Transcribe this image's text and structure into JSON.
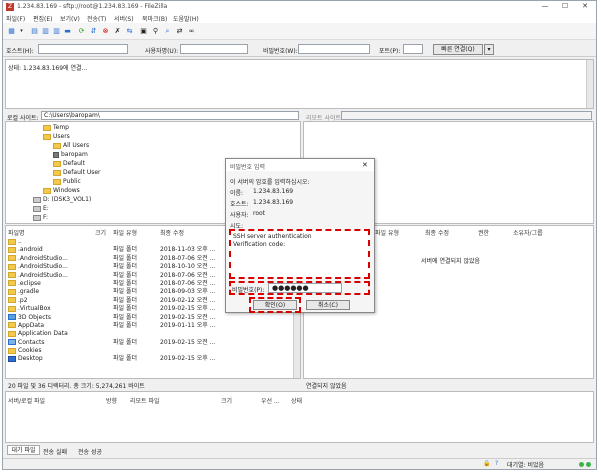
{
  "window": {
    "title": "1.234.83.169 - sftp://root@1.234.83.169 - FileZilla",
    "app_icon_letter": "Z",
    "controls": {
      "minimize": "—",
      "maximize": "☐",
      "close": "✕"
    }
  },
  "menu": [
    "파일(F)",
    "편집(E)",
    "보기(V)",
    "전송(T)",
    "서버(S)",
    "북마크(B)",
    "도움말(H)"
  ],
  "toolbar_icons": [
    "site-manager-icon",
    "dropdown-icon",
    "toggle-log-icon",
    "toggle-tree-local-icon",
    "toggle-tree-remote-icon",
    "transfer-queue-icon",
    "refresh-icon",
    "process-queue-icon",
    "cancel-icon",
    "disconnect-icon",
    "reconnect-icon",
    "directory-compare-icon",
    "filter-icon",
    "search-icon",
    "sync-browse-icon",
    "binoculars-icon"
  ],
  "quickconnect": {
    "host_label": "호스트(H):",
    "user_label": "사용자명(U):",
    "password_label": "비밀번호(W):",
    "port_label": "포트(P):",
    "connect_label": "빠른 연결(Q)",
    "dropdown": "▾"
  },
  "status_log": {
    "line": "상태:   1.234.83.169에 연결..."
  },
  "local": {
    "site_label": "로컬 사이트:",
    "path": "C:\\Users\\baropam\\",
    "tree": [
      "Temp",
      "Users",
      "All Users",
      "baropam",
      "Default",
      "Default User",
      "Public",
      "Windows",
      "D: (DSK3_VOL1)",
      "E:",
      "F:"
    ],
    "columns": [
      "파일명",
      "크기",
      "파일 유형",
      "최종 수정"
    ],
    "files": [
      {
        "name": "..",
        "size": "",
        "type": "",
        "modified": ""
      },
      {
        "name": ".android",
        "size": "",
        "type": "파일 폴더",
        "modified": "2018-11-03 오후 ..."
      },
      {
        "name": ".AndroidStudio...",
        "size": "",
        "type": "파일 폴더",
        "modified": "2018-07-06 오전 ..."
      },
      {
        "name": ".AndroidStudio...",
        "size": "",
        "type": "파일 폴더",
        "modified": "2018-10-10 오전 ..."
      },
      {
        "name": ".AndroidStudio...",
        "size": "",
        "type": "파일 폴더",
        "modified": "2018-07-06 오전 ..."
      },
      {
        "name": ".eclipse",
        "size": "",
        "type": "파일 폴더",
        "modified": "2018-07-06 오전 ..."
      },
      {
        "name": ".gradle",
        "size": "",
        "type": "파일 폴더",
        "modified": "2018-09-03 오후 ..."
      },
      {
        "name": ".p2",
        "size": "",
        "type": "파일 폴더",
        "modified": "2019-02-12 오전 ..."
      },
      {
        "name": ".VirtualBox",
        "size": "",
        "type": "파일 폴더",
        "modified": "2019-02-15 오후 ..."
      },
      {
        "name": "3D Objects",
        "size": "",
        "type": "파일 폴더",
        "modified": "2019-02-15 오전 ..."
      },
      {
        "name": "AppData",
        "size": "",
        "type": "파일 폴더",
        "modified": "2019-01-11 오후 ..."
      },
      {
        "name": "Application Data",
        "size": "",
        "type": "",
        "modified": ""
      },
      {
        "name": "Contacts",
        "size": "",
        "type": "파일 폴더",
        "modified": "2019-02-15 오전 ..."
      },
      {
        "name": "Cookies",
        "size": "",
        "type": "",
        "modified": ""
      },
      {
        "name": "Desktop",
        "size": "",
        "type": "파일 폴더",
        "modified": "2019-02-15 오후 ..."
      }
    ],
    "summary": "20 파일 및 36 디렉터리. 총 크기: 5,274,261 바이트"
  },
  "remote": {
    "site_label": "리모트 사이트:",
    "columns": [
      "파일명",
      "크기",
      "파일 유형",
      "최종 수정",
      "권한",
      "소유자/그룹"
    ],
    "empty_message": "서버에 연결되지 않았음",
    "status": "연결되지 않았음"
  },
  "queue": {
    "columns": [
      "서버/로컬 파일",
      "방향",
      "리모트 파일",
      "크기",
      "우선 ...",
      "상태"
    ],
    "tabs": [
      "대기 파일",
      "전송 실패",
      "전송 성공"
    ],
    "footer_status": "대기열: 비었음"
  },
  "password_dialog": {
    "title": "비밀번호 입력",
    "close": "✕",
    "prompt": "이 서버의 암호를 입력하십시오:",
    "name_label": "이름:",
    "name_value": "1.234.83.169",
    "host_label": "호스트:",
    "host_value": "1.234.83.169",
    "user_label": "사용자:",
    "user_value": "root",
    "challenge_label": "시도:",
    "challenge_line1": "SSH server authentication",
    "challenge_line2": "Verification code:",
    "password_label": "비밀번호(P):",
    "password_value": "●●●●●●",
    "ok_label": "확인(O)",
    "cancel_label": "취소(C)"
  },
  "colors": {
    "highlight": "#d90000",
    "folder": "#f2c94c",
    "accent": "#2a6fd0"
  }
}
